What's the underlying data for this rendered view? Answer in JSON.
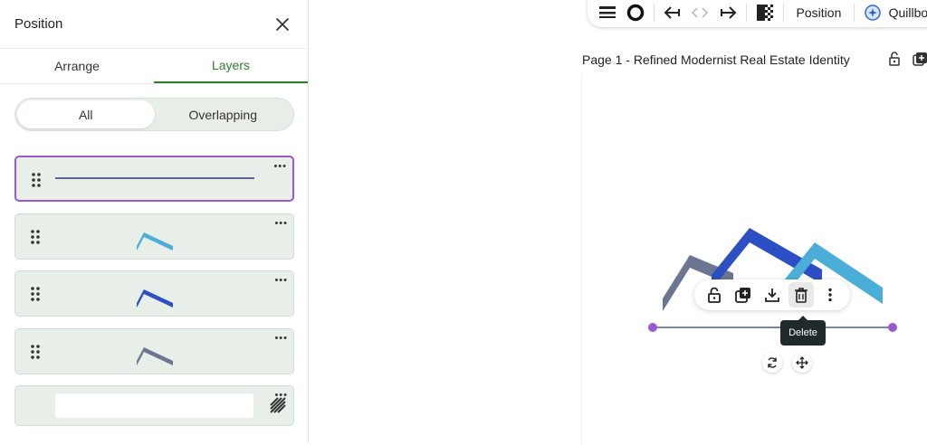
{
  "panel": {
    "title": "Position",
    "tabs": [
      {
        "label": "Arrange",
        "active": false
      },
      {
        "label": "Layers",
        "active": true
      }
    ],
    "filter": [
      {
        "label": "All",
        "active": true
      },
      {
        "label": "Overlapping",
        "active": false
      }
    ],
    "layers": [
      {
        "name": "line",
        "selected": true,
        "color": "#2d3a7a"
      },
      {
        "name": "mountain-light-blue",
        "selected": false,
        "color": "#4aaed9"
      },
      {
        "name": "mountain-blue",
        "selected": false,
        "color": "#2d4fc4"
      },
      {
        "name": "mountain-gray",
        "selected": false,
        "color": "#6c7591"
      },
      {
        "name": "background",
        "selected": false,
        "color": "#ffffff"
      }
    ]
  },
  "toolbar": {
    "position_label": "Position",
    "quillbot_label": "Quillbot"
  },
  "page": {
    "title": "Page 1 - Refined Modernist Real Estate Identity"
  },
  "context_toolbar": {
    "tooltip": "Delete"
  },
  "colors": {
    "accent_green": "#2e7d32",
    "selection_purple": "#9b59d0",
    "layer_bg": "#e8efe8"
  }
}
